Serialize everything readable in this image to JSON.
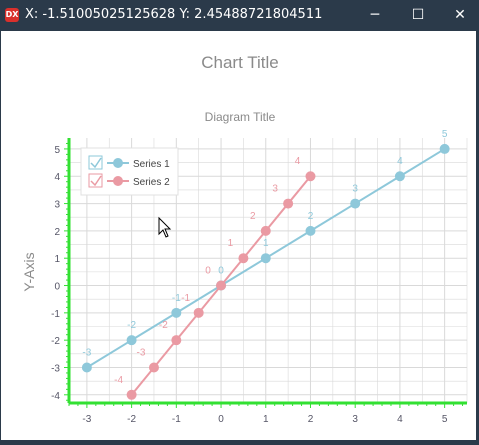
{
  "window": {
    "app_icon_text": "DX",
    "title": "X: -1.51005025125628 Y: 2.45488721804511",
    "minimize_glyph": "─",
    "maximize_glyph": "☐",
    "close_glyph": "✕"
  },
  "chart_data": {
    "type": "line",
    "title": "Chart Title",
    "subtitle": "Diagram Title",
    "ylabel": "Y-Axis",
    "xlabel": "",
    "xlim": [
      -3.4,
      5.5
    ],
    "ylim": [
      -4.3,
      5.4
    ],
    "x_ticks": [
      -3,
      -2,
      -1,
      0,
      1,
      2,
      3,
      4,
      5
    ],
    "y_ticks": [
      -4,
      -3,
      -2,
      -1,
      0,
      1,
      2,
      3,
      4,
      5
    ],
    "grid": true,
    "legend": "top-left",
    "series": [
      {
        "name": "Series 1",
        "color": "#8ec8da",
        "points": [
          [
            -3,
            -3
          ],
          [
            -2,
            -2
          ],
          [
            -1,
            -1
          ],
          [
            0,
            0
          ],
          [
            1,
            1
          ],
          [
            2,
            2
          ],
          [
            3,
            3
          ],
          [
            4,
            4
          ],
          [
            5,
            5
          ]
        ],
        "labels": [
          "-3",
          "-2",
          "-1",
          "0",
          "1",
          "2",
          "3",
          "4",
          "5"
        ]
      },
      {
        "name": "Series 2",
        "color": "#ea9aa3",
        "points": [
          [
            -2,
            -4
          ],
          [
            -1.5,
            -3
          ],
          [
            -1,
            -2
          ],
          [
            -0.5,
            -1
          ],
          [
            0,
            0
          ],
          [
            0.5,
            1
          ],
          [
            1,
            2
          ],
          [
            1.5,
            3
          ],
          [
            2,
            4
          ]
        ],
        "labels": [
          "-4",
          "-3",
          "-2",
          "-1",
          "0",
          "1",
          "2",
          "3",
          "4"
        ]
      }
    ],
    "colors": {
      "axis": "#32e032",
      "grid": "#d9d9d9",
      "tick_text": "#555566",
      "title": "#8a8a8a"
    }
  }
}
